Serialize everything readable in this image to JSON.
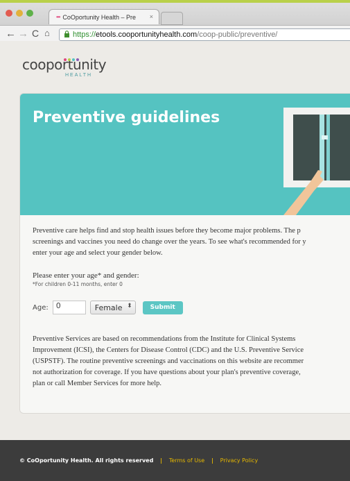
{
  "browser": {
    "tab_title": "CoOportunity Health – Pre",
    "tab_close": "×",
    "url_scheme": "https://",
    "url_host": "etools.cooportunityhealth.com",
    "url_path": "/coop-public/preventive/"
  },
  "logo": {
    "main": "cooportunity",
    "sub": "HEALTH"
  },
  "hero": {
    "title": "Preventive guidelines"
  },
  "intro": [
    "Preventive care helps find and stop health issues before they become major problems. The p",
    "screenings and vaccines you need do change over the years. To see what's recommended for y",
    "enter your age and select your gender below."
  ],
  "form": {
    "prompt": "Please enter your age* and gender:",
    "note": "*For children 0-11 months, enter 0",
    "age_label": "Age:",
    "age_value": "0",
    "gender_value": "Female",
    "gender_chevron": "⬍",
    "submit_label": "Submit"
  },
  "disclaimer": [
    "Preventive Services are based on recommendations from the Institute for Clinical Systems",
    "Improvement (ICSI), the Centers for Disease Control (CDC) and the U.S. Preventive Service",
    "(USPSTF). The routine preventive screenings and vaccinations on this website are recommer",
    "not authorization for coverage. If you have questions about your plan's preventive coverage,",
    "plan or call Member Services for more help."
  ],
  "footer": {
    "copyright": "© CoOportunity Health.  All rights reserved",
    "separator": "|",
    "terms": "Terms of Use",
    "privacy": "Privacy Policy"
  },
  "colors": {
    "accent": "#55c3c1",
    "footer_bg": "#3c3c3c",
    "footer_link": "#e6b800"
  }
}
